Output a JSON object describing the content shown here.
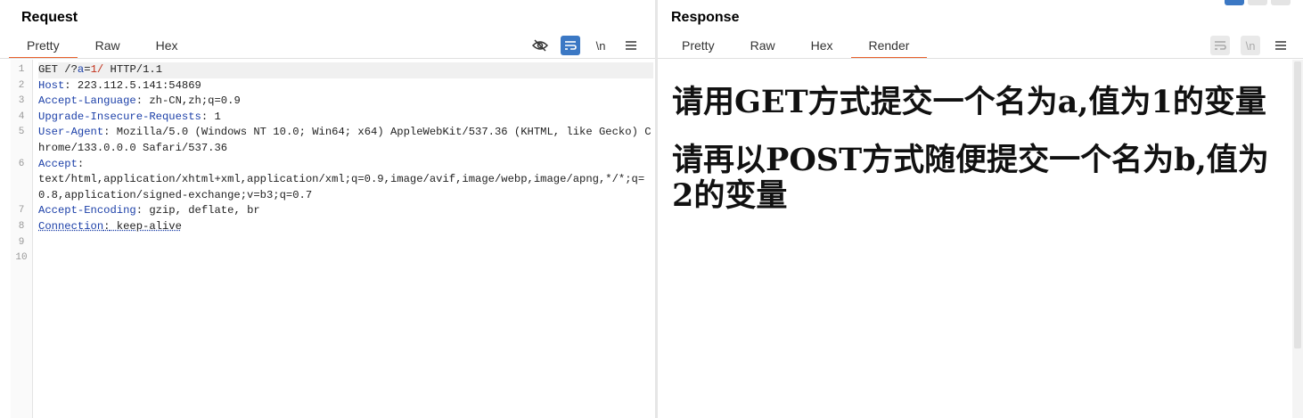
{
  "request": {
    "title": "Request",
    "tabs": [
      "Pretty",
      "Raw",
      "Hex"
    ],
    "active_tab": "Pretty",
    "toolbar": {
      "hide_icon": "eye-slash-icon",
      "wrap_icon": "wrap-icon",
      "newline_label": "\\n",
      "menu_icon": "hamburger-icon"
    },
    "lines": {
      "l1": {
        "method": "GET",
        "path_pre": "/?",
        "param_key": "a",
        "eq": "=",
        "param_val": "1/",
        "proto": " HTTP/1.1"
      },
      "l2": {
        "key": "Host",
        "value": " 223.112.5.141:54869"
      },
      "l3": {
        "key": "Accept-Language",
        "value": " zh-CN,zh;q=0.9"
      },
      "l4": {
        "key": "Upgrade-Insecure-Requests",
        "value": " 1"
      },
      "l5": {
        "key": "User-Agent",
        "value": " Mozilla/5.0 (Windows NT 10.0; Win64; x64) AppleWebKit/537.36 (KHTML, like Gecko) Chrome/133.0.0.0 Safari/537.36"
      },
      "l6": {
        "key": "Accept",
        "value": "text/html,application/xhtml+xml,application/xml;q=0.9,image/avif,image/webp,image/apng,*/*;q=0.8,application/signed-exchange;v=b3;q=0.7"
      },
      "l7": {
        "key": "Accept-Encoding",
        "value": " gzip, deflate, br"
      },
      "l8": {
        "key": "Connection",
        "value": " keep-alive"
      }
    },
    "line_numbers": [
      "1",
      "2",
      "3",
      "4",
      "5",
      "6",
      "7",
      "8",
      "9",
      "10"
    ]
  },
  "response": {
    "title": "Response",
    "tabs": [
      "Pretty",
      "Raw",
      "Hex",
      "Render"
    ],
    "active_tab": "Render",
    "toolbar": {
      "wrap_icon": "wrap-icon",
      "newline_label": "\\n",
      "menu_icon": "hamburger-icon"
    },
    "render": {
      "para1": "请用GET方式提交一个名为a,值为1的变量",
      "para2": "请再以POST方式随便提交一个名为b,值为2的变量"
    }
  },
  "colors": {
    "accent_tab": "#e8612c",
    "header_key": "#1b3fa8",
    "param_value": "#c2301a",
    "toolbar_blue": "#3b78c4"
  }
}
